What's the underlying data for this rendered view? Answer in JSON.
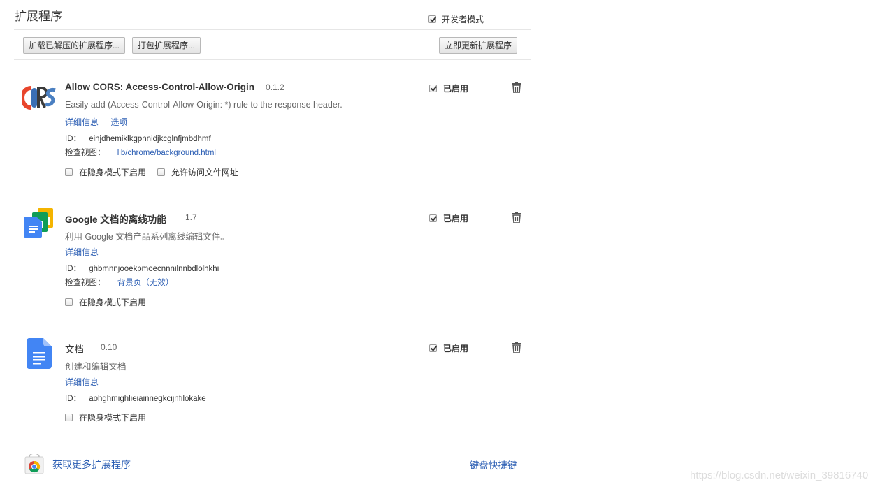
{
  "header": {
    "title": "扩展程序",
    "developer_mode_label": "开发者模式",
    "developer_mode_checked": true
  },
  "toolbar": {
    "load_unpacked": "加载已解压的扩展程序...",
    "pack": "打包扩展程序...",
    "update_now": "立即更新扩展程序"
  },
  "extensions": [
    {
      "icon": "cors-logo-icon",
      "name": "Allow CORS: Access-Control-Allow-Origin",
      "version": "0.1.2",
      "description": "Easily add (Access-Control-Allow-Origin: *) rule to the response header.",
      "links": [
        "详细信息",
        "选项"
      ],
      "id_label": "ID：",
      "id": "einjdhemiklkgpnnidjkcglnfjmbdhmf",
      "inspect_label": "检查视图：",
      "inspect_link": "lib/chrome/background.html",
      "options": [
        {
          "label": "在隐身模式下启用",
          "checked": false
        },
        {
          "label": "允许访问文件网址",
          "checked": false
        }
      ],
      "enabled_label": "已启用",
      "enabled": true
    },
    {
      "icon": "google-docs-offline-icon",
      "name": "Google 文档的离线功能",
      "version": "1.7",
      "description": "利用 Google 文档产品系列离线编辑文件。",
      "links": [
        "详细信息"
      ],
      "id_label": "ID：",
      "id": "ghbmnnjooekpmoecnnnilnnbdlolhkhi",
      "inspect_label": "检查视图：",
      "inspect_link": "背景页（无效）",
      "options": [
        {
          "label": "在隐身模式下启用",
          "checked": false
        }
      ],
      "enabled_label": "已启用",
      "enabled": true
    },
    {
      "icon": "google-docs-icon",
      "name": "文档",
      "version": "0.10",
      "description": "创建和编辑文档",
      "links": [
        "详细信息"
      ],
      "id_label": "ID：",
      "id": "aohghmighlieiainnegkcijnfilokake",
      "options": [
        {
          "label": "在隐身模式下启用",
          "checked": false
        }
      ],
      "enabled_label": "已启用",
      "enabled": true
    }
  ],
  "footer": {
    "get_more": "获取更多扩展程序",
    "shortcuts": "键盘快捷键"
  },
  "watermark": "https://blog.csdn.net/weixin_39816740",
  "colors": {
    "link": "#2d5fb4",
    "cors_c": "#e8452c",
    "cors_o": "#3a6fb5",
    "cors_r": "#3b3b3b",
    "cors_s": "#4a7fc1",
    "docs_blue": "#4285f4"
  }
}
